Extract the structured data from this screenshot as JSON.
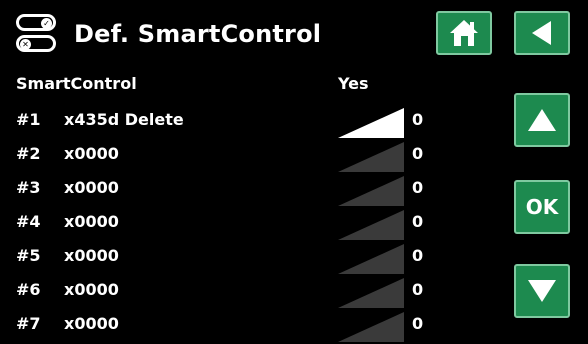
{
  "header": {
    "title": "Def. SmartControl",
    "title_icon": "toggle-switches-icon"
  },
  "nav": {
    "home_icon": "house-icon",
    "back_icon": "triangle-left-icon",
    "up_icon": "triangle-up-icon",
    "ok_label": "OK",
    "down_icon": "triangle-down-icon"
  },
  "table": {
    "label": "SmartControl",
    "value": "Yes",
    "rows": [
      {
        "num": "#1",
        "name": "x435d Delete",
        "level": 1.0,
        "value": "0"
      },
      {
        "num": "#2",
        "name": "x0000",
        "level": 0,
        "value": "0"
      },
      {
        "num": "#3",
        "name": "x0000",
        "level": 0,
        "value": "0"
      },
      {
        "num": "#4",
        "name": "x0000",
        "level": 0,
        "value": "0"
      },
      {
        "num": "#5",
        "name": "x0000",
        "level": 0,
        "value": "0"
      },
      {
        "num": "#6",
        "name": "x0000",
        "level": 0,
        "value": "0"
      },
      {
        "num": "#7",
        "name": "x0000",
        "level": 0,
        "value": "0"
      }
    ]
  },
  "colors": {
    "button": "#1d8a4f",
    "button_border": "#7fc9a0",
    "ramp_active": "#ffffff",
    "ramp_inactive": "#3a3a3a"
  }
}
